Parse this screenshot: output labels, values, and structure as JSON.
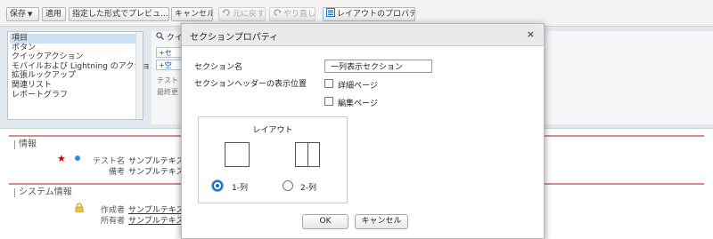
{
  "toolbar": {
    "save": "保存",
    "apply": "適用",
    "preview": "指定した形式でプレビュ...",
    "cancel": "キャンセル",
    "undo": "元に戻す",
    "redo": "やり直し",
    "layout_props": "レイアウトのプロパティ"
  },
  "palette": {
    "categories": [
      "項目",
      "ボタン",
      "クイックアクション",
      "モバイルおよび Lightning のアクション",
      "拡張ルックアップ",
      "関連リスト",
      "レポートグラフ"
    ],
    "selected_index": 0,
    "search_label": "クイ",
    "chip1": "セ",
    "chip2": "空",
    "text1": "テスト",
    "text2": "最終更"
  },
  "page": {
    "section1_title": "情報",
    "field1_label": "テスト名",
    "field1_value": "サンプルテキスト",
    "field2_label": "備考",
    "field2_value": "サンプルテキスト",
    "section2_title": "システム情報",
    "field3_label": "作成者",
    "field3_value": "サンプルテキスト",
    "field4_label": "所有者",
    "field4_value": "サンプルテキスト"
  },
  "modal": {
    "title": "セクションプロパティ",
    "close": "×",
    "section_name_label": "セクション名",
    "section_name_value": "一列表示セクション",
    "header_display_label": "セクションヘッダーの表示位置",
    "detail_page_label": "詳細ページ",
    "edit_page_label": "編集ページ",
    "detail_page_checked": false,
    "edit_page_checked": false,
    "layout_title": "レイアウト",
    "one_col_label": "1-列",
    "two_col_label": "2-列",
    "selected_layout": "1-列",
    "ok_label": "OK",
    "cancel_label": "キャンセル"
  },
  "colors": {
    "section_rule": "#d88a8a",
    "radio_accent": "#1b6ec2",
    "palette_bg": "#e2e8ee",
    "selected_item": "#cfe0f3"
  }
}
